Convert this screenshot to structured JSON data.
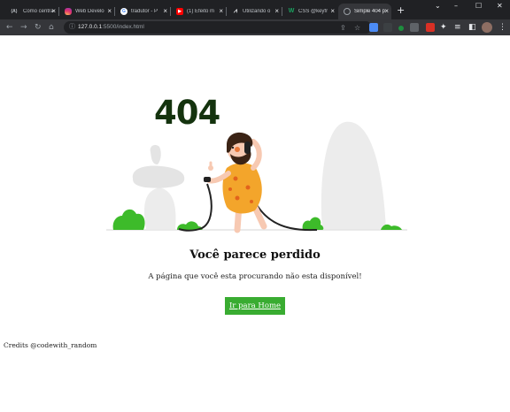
{
  "browser": {
    "tabs": [
      {
        "label": "Como centra",
        "icon": "(A)",
        "color": "#5f6368"
      },
      {
        "label": "Web Develo",
        "icon": "instagram",
        "color": "#e1306c"
      },
      {
        "label": "tradutor - P",
        "icon": "G",
        "color": "#ffffff"
      },
      {
        "label": "(1) Efeito m",
        "icon": "youtube",
        "color": "#ff0000"
      },
      {
        "label": "Utilizando o",
        "icon": "M",
        "color": "#202124"
      },
      {
        "label": "CSS @keyfr",
        "icon": "W",
        "color": "#1aa260"
      },
      {
        "label": "Simple 404 p",
        "icon": "globe",
        "color": "#9aa0a6"
      }
    ],
    "active_tab": 6,
    "new_tab_label": "+",
    "url_host": "127.0.0.1",
    "url_rest": ":5500/index.html",
    "window_controls": {
      "minimize": "–",
      "maximize": "☐",
      "close": "✕"
    }
  },
  "page": {
    "code": "404",
    "heading": "Você parece perdido",
    "description": "A página que você esta procurando não esta disponível!",
    "button_label": "Ir para Home",
    "credits": "Credits @codewith_random"
  },
  "colors": {
    "accent": "#39ac31",
    "code_text": "#14330e",
    "rock": "#ececec",
    "bush": "#3dbb2a",
    "tunic": "#f3a52b",
    "tunic_spots": "#e2631c",
    "hair": "#3b2315",
    "skin": "#f7c9b2"
  }
}
